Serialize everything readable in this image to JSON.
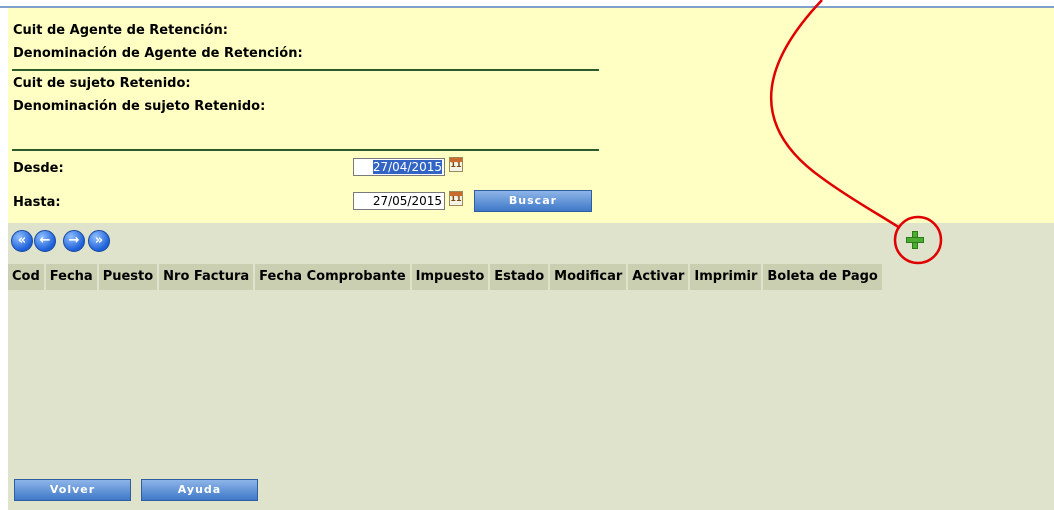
{
  "info": {
    "agent_cuit_label": "Cuit de Agente de Retención:",
    "agent_name_label": "Denominación de Agente de Retención:",
    "subject_cuit_label": "Cuit de sujeto Retenido:",
    "subject_name_label": "Denominación de sujeto Retenido:",
    "from_label": "Desde:",
    "to_label": "Hasta:"
  },
  "filters": {
    "from_value": "27/04/2015",
    "to_value": "27/05/2015",
    "search_button": "Buscar"
  },
  "calendar_icon_text": "11",
  "pager": {
    "first": "«",
    "prev": "←",
    "next": "→",
    "last": "»"
  },
  "grid": {
    "columns": [
      "Cod",
      "Fecha",
      "Puesto",
      "Nro Factura",
      "Fecha Comprobante",
      "Impuesto",
      "Estado",
      "Modificar",
      "Activar",
      "Imprimir",
      "Boleta de Pago"
    ]
  },
  "footer": {
    "back_button": "Volver",
    "help_button": "Ayuda"
  },
  "colors": {
    "info_background": "#ffffc4",
    "grid_background": "#dfe3cc",
    "header_background": "#c9cfb0",
    "annotation": "#e00000"
  },
  "icons": [
    "calendar-icon",
    "first-page-icon",
    "prev-page-icon",
    "next-page-icon",
    "last-page-icon",
    "add-plus-icon"
  ]
}
